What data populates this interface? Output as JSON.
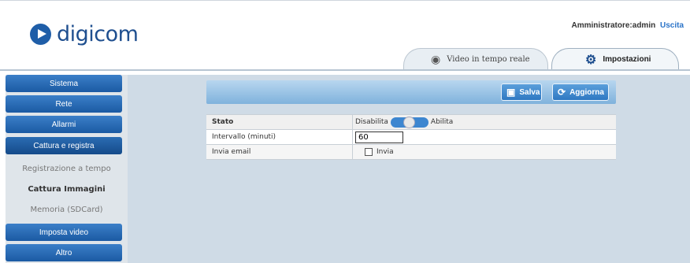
{
  "brand": {
    "name": "digicom"
  },
  "user": {
    "label": "Amministratore:admin",
    "logout": "Uscita"
  },
  "tabs": [
    {
      "label": "Video in tempo reale",
      "icon": "webcam-icon"
    },
    {
      "label": "Impostazioni",
      "icon": "gears-icon",
      "active": true
    }
  ],
  "sidebar": {
    "items": [
      {
        "label": "Sistema"
      },
      {
        "label": "Rete"
      },
      {
        "label": "Allarmi"
      },
      {
        "label": "Cattura e registra",
        "active": true
      },
      {
        "label": "Imposta video"
      },
      {
        "label": "Altro"
      }
    ],
    "subitems": [
      {
        "label": "Registrazione a tempo"
      },
      {
        "label": "Cattura Immagini",
        "selected": true
      },
      {
        "label": "Memoria (SDCard)"
      }
    ]
  },
  "toolbar": {
    "save_label": "Salva",
    "refresh_label": "Aggiorna"
  },
  "form": {
    "status_label": "Stato",
    "status_off": "Disabilita",
    "status_on": "Abilita",
    "interval_label": "Intervallo (minuti)",
    "interval_value": "60",
    "email_label": "Invia email",
    "email_checkbox_label": "Invia",
    "email_checked": false
  },
  "colors": {
    "accent": "#2f78c2",
    "background": "#cfdbe6",
    "brand": "#1f4f8f"
  }
}
